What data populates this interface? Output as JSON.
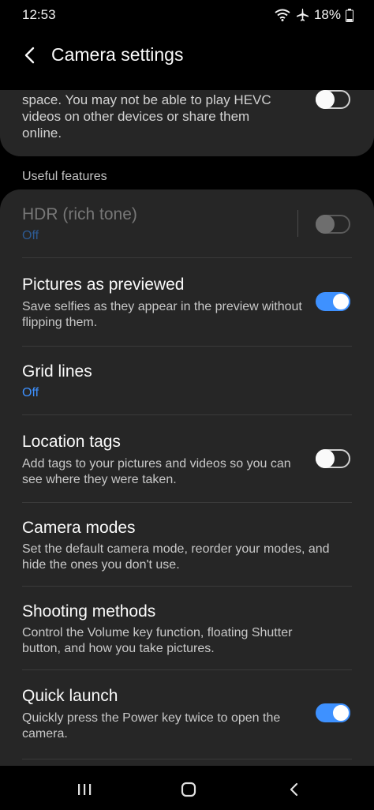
{
  "status": {
    "time": "12:53",
    "battery": "18%",
    "icons": [
      "wifi-icon",
      "airplane-mode-icon",
      "battery-icon"
    ]
  },
  "header": {
    "title": "Camera settings"
  },
  "hevc": {
    "text": "space. You may not be able to play HEVC videos on other devices or share them online.",
    "toggle_on": false
  },
  "section": {
    "useful_features": "Useful features"
  },
  "items": {
    "hdr": {
      "title": "HDR (rich tone)",
      "value": "Off",
      "toggle_on": false,
      "enabled": false
    },
    "pictures_previewed": {
      "title": "Pictures as previewed",
      "subtitle": "Save selfies as they appear in the preview without flipping them.",
      "toggle_on": true
    },
    "grid_lines": {
      "title": "Grid lines",
      "value": "Off"
    },
    "location_tags": {
      "title": "Location tags",
      "subtitle": "Add tags to your pictures and videos so you can see where they were taken.",
      "toggle_on": false
    },
    "camera_modes": {
      "title": "Camera modes",
      "subtitle": "Set the default camera mode, reorder your modes, and hide the ones you don't use."
    },
    "shooting_methods": {
      "title": "Shooting methods",
      "subtitle": "Control the Volume key function, floating Shutter button, and how you take pictures."
    },
    "quick_launch": {
      "title": "Quick launch",
      "subtitle": "Quickly press the Power key twice to open the camera.",
      "toggle_on": true
    }
  },
  "nav": {
    "icons": [
      "recent-apps-icon",
      "home-icon",
      "back-icon"
    ]
  },
  "colors": {
    "accent": "#3e91ff",
    "card": "#262626",
    "background": "#000000"
  }
}
